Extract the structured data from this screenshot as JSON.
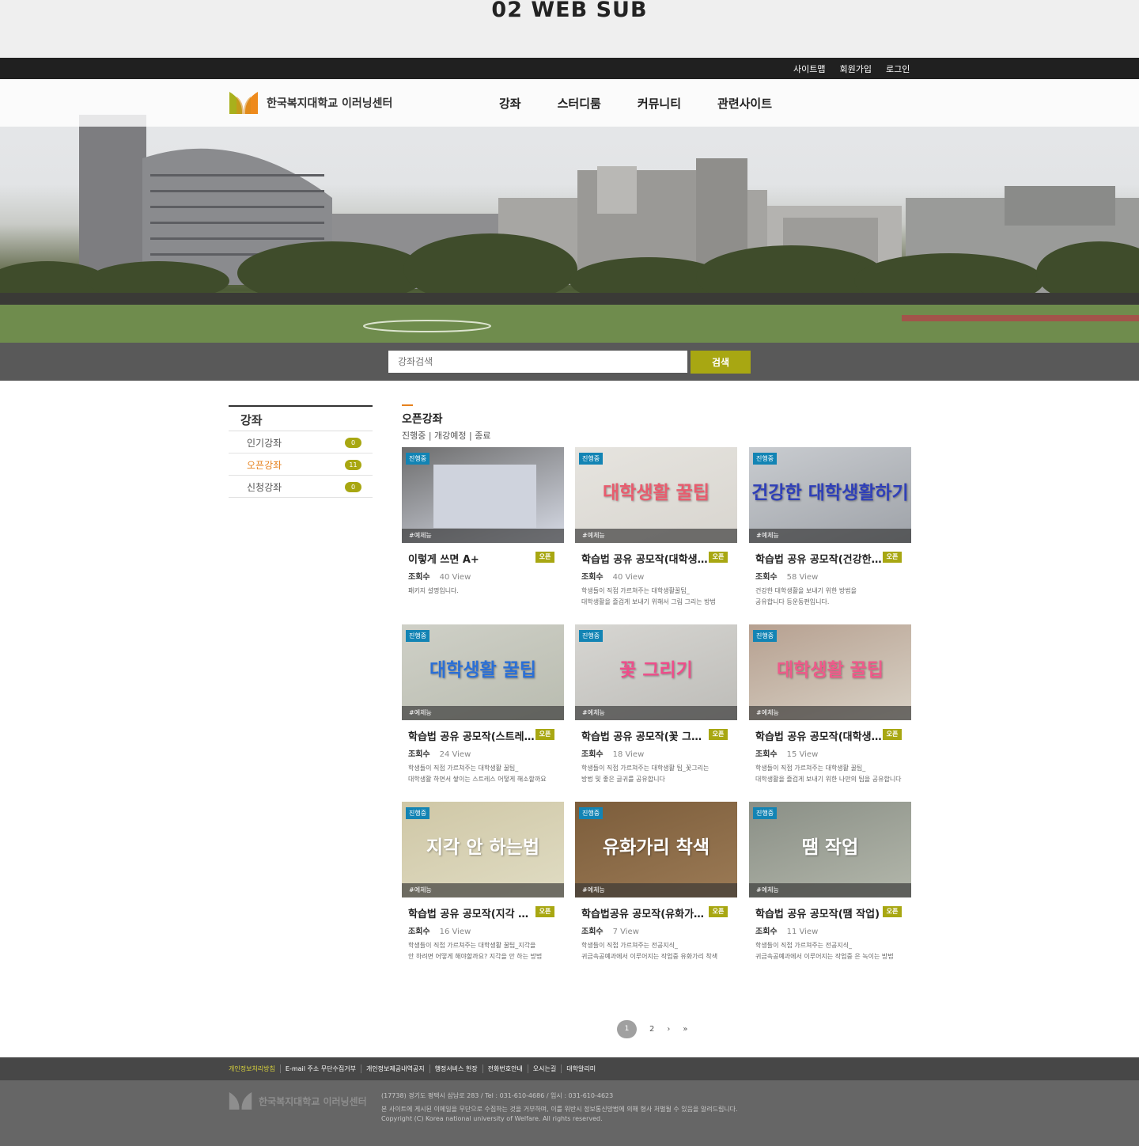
{
  "page_header": {
    "title": "02 WEB SUB"
  },
  "topbar": {
    "links": [
      "사이트맵",
      "회원가입",
      "로그인"
    ]
  },
  "nav": {
    "logo_text": "한국복지대학교 이러닝센터",
    "menu": [
      "강좌",
      "스터디룸",
      "커뮤니티",
      "관련사이트"
    ]
  },
  "search": {
    "placeholder": "강좌검색",
    "button": "검색"
  },
  "sidebar": {
    "title": "강좌",
    "items": [
      {
        "label": "인기강좌",
        "count": "0"
      },
      {
        "label": "오픈강좌",
        "count": "11"
      },
      {
        "label": "신청강좌",
        "count": "0"
      }
    ]
  },
  "main": {
    "title": "오픈강좌",
    "filters": "진행중 | 개강예정 | 종료"
  },
  "cards": [
    {
      "status": "진행중",
      "tag": "#예체능",
      "thumb_text": "",
      "title": "이렇게 쓰면 A+",
      "badge": "오픈",
      "views_label": "조회수",
      "views": "40 View",
      "desc": [
        "패키지 설명입니다.",
        ""
      ]
    },
    {
      "status": "진행중",
      "tag": "#예체능",
      "thumb_text": "대학생활 꿀팁",
      "title": "학습법 공유 공모작(대학생활 꿀팁)",
      "badge": "오픈",
      "views_label": "조회수",
      "views": "40 View",
      "desc": [
        "학생들이 직접 가르쳐주는 대학생활꿀팁_",
        "대학생활을 즐겁게 보내기 위해서 그림 그리는 방법"
      ]
    },
    {
      "status": "진행중",
      "tag": "#예체능",
      "thumb_text": "건강한 대학생활하기",
      "title": "학습법 공유 공모작(건강한 대학생활)",
      "badge": "오픈",
      "views_label": "조회수",
      "views": "58 View",
      "desc": [
        "건강한 대학생활을 보내기 위한 방법을",
        "공유합니다 등운동편입니다."
      ]
    },
    {
      "status": "진행중",
      "tag": "#예체능",
      "thumb_text": "대학생활 꿀팁",
      "title": "학습법 공유 공모작(스트레스)",
      "badge": "오픈",
      "views_label": "조회수",
      "views": "24 View",
      "desc": [
        "학생들이 직접 가르쳐주는 대학생활 꿀팁_",
        "대학생활 하면서 쌓이는 스트레스 어떻게 해소할까요"
      ]
    },
    {
      "status": "진행중",
      "tag": "#예체능",
      "thumb_text": "꽃 그리기",
      "title": "학습법 공유 공모작(꽃 그리기)",
      "badge": "오픈",
      "views_label": "조회수",
      "views": "18 View",
      "desc": [
        "학생들이 직접 가르쳐주는 대학생활 팁_꽃그리는",
        "방법 및 좋은 글귀를 공유합니다"
      ]
    },
    {
      "status": "진행중",
      "tag": "#예체능",
      "thumb_text": "대학생활 꿀팁",
      "title": "학습법 공유 공모작(대학생활 꿀팁)",
      "badge": "오픈",
      "views_label": "조회수",
      "views": "15 View",
      "desc": [
        "학생들이 직접 가르쳐주는 대학생활 꿀팁_",
        "대학생활을 즐겁게 보내기 위한 나만의 팁을 공유합니다"
      ]
    },
    {
      "status": "진행중",
      "tag": "#예체능",
      "thumb_text": "지각 안 하는법",
      "title": "학습법 공유 공모작(지각 안 하는법)",
      "badge": "오픈",
      "views_label": "조회수",
      "views": "16 View",
      "desc": [
        "학생들이 직접 가르쳐주는 대학생활 꿀팁_지각을",
        "안 하려면 어떻게 해야할까요? 지각을 안 하는 방법"
      ]
    },
    {
      "status": "진행중",
      "tag": "#예체능",
      "thumb_text": "유화가리 착색",
      "title": "학습법공유 공모작(유화가리 착색)",
      "badge": "오픈",
      "views_label": "조회수",
      "views": "7 View",
      "desc": [
        "학생들이 직접 가르쳐주는 전공지식_",
        "귀금속공예과에서 이루어지는 작업중 유화가리 착색"
      ]
    },
    {
      "status": "진행중",
      "tag": "#예체능",
      "thumb_text": "땜 작업",
      "title": "학습법 공유 공모작(땜 작업)",
      "badge": "오픈",
      "views_label": "조회수",
      "views": "11 View",
      "desc": [
        "학생들이 직접 가르쳐주는 전공지식_",
        "귀금속공예과에서 이루어지는 작업중 은 녹이는 방법"
      ]
    }
  ],
  "pager": {
    "current": "1",
    "next_page": "2",
    "next": "›",
    "last": "»"
  },
  "footer": {
    "links": [
      "개인정보처리방침",
      "E-mail 주소 무단수집거부",
      "개인정보제공내역공지",
      "행정서비스 헌장",
      "전화번호안내",
      "오시는길",
      "대학알리미"
    ],
    "logo_text": "한국복지대학교 이러닝센터",
    "address": "(17738) 경기도 평택시 삼남로 283  / Tel : 031-610-4686  / 입시 : 031-610-4623",
    "notice": "본 사이트에 게시된 이메일을 무단으로 수집하는 것을 거부하며, 이를 위반시 정보통신망법에 의해 형사 처벌될 수 있음을 알려드립니다.",
    "copyright": "Copyright (C) Korea national university of Welfare. All rights reserved."
  }
}
